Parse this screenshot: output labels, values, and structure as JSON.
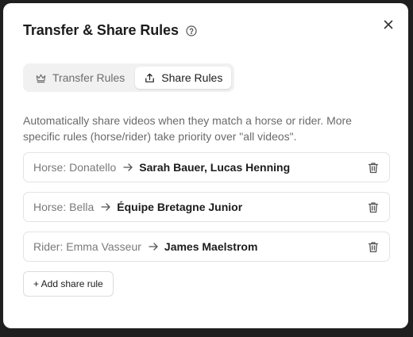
{
  "dialog": {
    "title": "Transfer & Share Rules",
    "help_icon": "help-circle-icon",
    "close_icon": "close-icon"
  },
  "tabs": [
    {
      "label": "Transfer Rules",
      "icon": "crown-icon",
      "active": false
    },
    {
      "label": "Share Rules",
      "icon": "share-icon",
      "active": true
    }
  ],
  "description": "Automatically share videos when they match a horse or rider. More specific rules (horse/rider) take priority over \"all videos\".",
  "rules": [
    {
      "source": "Horse: Donatello",
      "target": "Sarah Bauer, Lucas Henning"
    },
    {
      "source": "Horse: Bella",
      "target": "Équipe Bretagne Junior"
    },
    {
      "source": "Rider: Emma Vasseur",
      "target": "James Maelstrom"
    }
  ],
  "add_button_label": "+ Add share rule",
  "colors": {
    "text_primary": "#1c1c1c",
    "text_muted": "#6a6a6a",
    "border": "#e3e3e3",
    "tab_bg": "#f1f1f1"
  }
}
